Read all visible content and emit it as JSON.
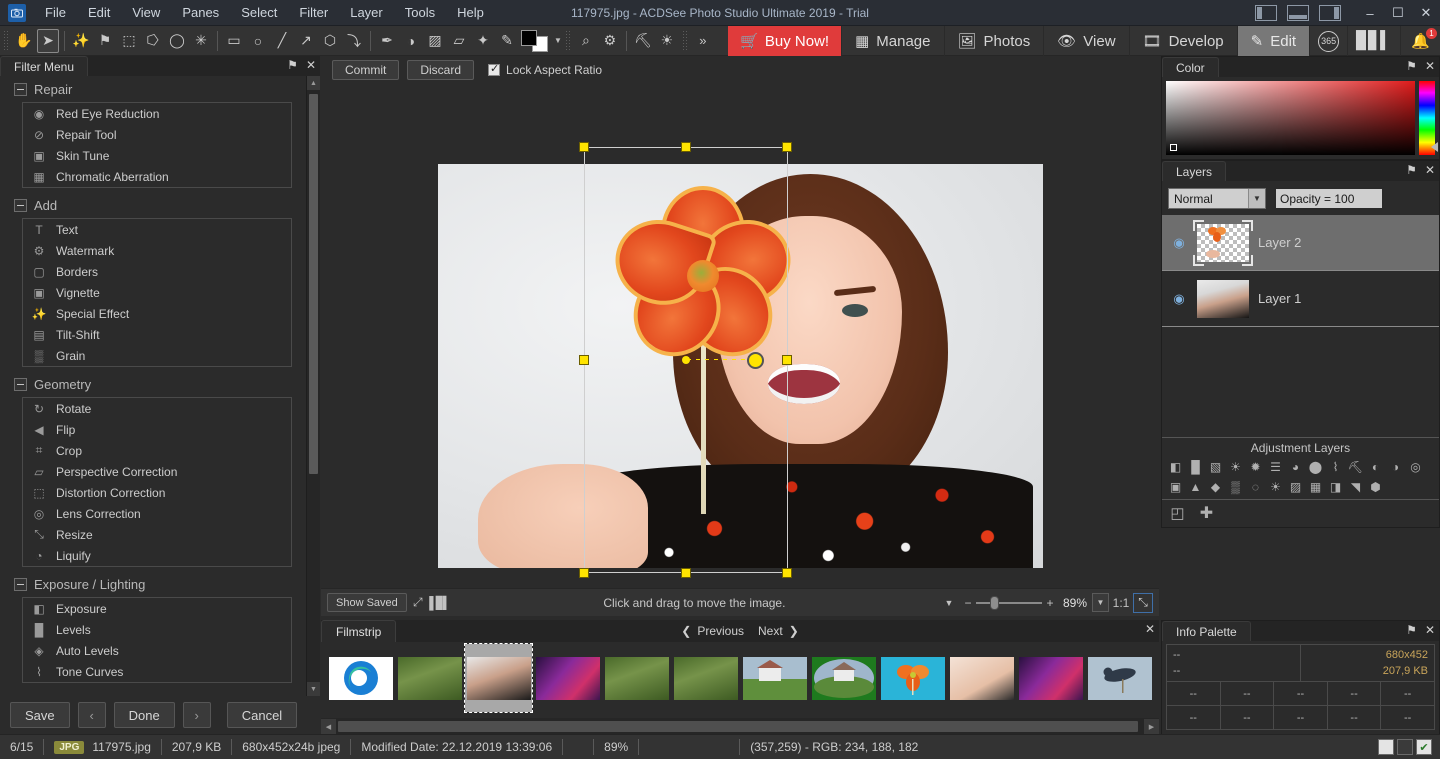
{
  "window": {
    "title": "117975.jpg - ACDSee Photo Studio Ultimate 2019 - Trial",
    "logo_icon": "camera-icon",
    "minimize_label": "–",
    "maximize_label": "☐",
    "close_label": "✕",
    "pane_left_name": "toggle-left-pane",
    "pane_bottom_name": "toggle-bottom-pane",
    "pane_right_name": "toggle-right-pane"
  },
  "menubar": {
    "items": [
      "File",
      "Edit",
      "View",
      "Panes",
      "Select",
      "Filter",
      "Layer",
      "Tools",
      "Help"
    ]
  },
  "toolbar": {
    "tools": [
      {
        "name": "hand-tool-icon",
        "glyph": "✋"
      },
      {
        "name": "move-tool-icon",
        "glyph": "➤",
        "active": true
      },
      {
        "name": "magic-wand-select-icon",
        "glyph": "✨"
      },
      {
        "name": "flag-select-icon",
        "glyph": "⚑"
      },
      {
        "name": "smart-select-icon",
        "glyph": "⬚"
      },
      {
        "name": "freehand-select-icon",
        "glyph": "⭔"
      },
      {
        "name": "lasso-select-icon",
        "glyph": "◯"
      },
      {
        "name": "magic-select-icon",
        "glyph": "✳"
      },
      {
        "name": "rectangle-shape-icon",
        "glyph": "▭"
      },
      {
        "name": "ellipse-shape-icon",
        "glyph": "○"
      },
      {
        "name": "line-shape-icon",
        "glyph": "╱"
      },
      {
        "name": "arrow-shape-icon",
        "glyph": "↗"
      },
      {
        "name": "polygon-shape-icon",
        "glyph": "⬡"
      },
      {
        "name": "curve-shape-icon",
        "glyph": "⤵"
      },
      {
        "name": "pen-tool-icon",
        "glyph": "✒"
      },
      {
        "name": "fill-tool-icon",
        "glyph": "◑"
      },
      {
        "name": "gradient-tool-icon",
        "glyph": "▨"
      },
      {
        "name": "eraser-tool-icon",
        "glyph": "▱"
      },
      {
        "name": "blemish-remover-icon",
        "glyph": "✦"
      },
      {
        "name": "brush-tool-icon",
        "glyph": "✎"
      }
    ],
    "extra_tools": [
      {
        "name": "zoom-tool-icon",
        "glyph": "⌕"
      },
      {
        "name": "settings-tool-icon",
        "glyph": "⚙"
      },
      {
        "name": "dodge-tool-icon",
        "glyph": "⛏"
      },
      {
        "name": "burn-tool-icon",
        "glyph": "☀"
      }
    ],
    "color_well_name": "foreground-background-color-well",
    "foreground_color": "#000000",
    "background_color": "#ffffff",
    "overflow_label": "»"
  },
  "modes": {
    "buy_now": "Buy Now!",
    "items": [
      {
        "label": "Manage",
        "icon": "grid-icon",
        "selected": false
      },
      {
        "label": "Photos",
        "icon": "photos-icon",
        "selected": false
      },
      {
        "label": "View",
        "icon": "eye-icon",
        "selected": false
      },
      {
        "label": "Develop",
        "icon": "develop-icon",
        "selected": false
      },
      {
        "label": "Edit",
        "icon": "edit-icon",
        "selected": true
      }
    ],
    "cloud_365": "365",
    "stats_icon": "bar-chart-icon",
    "notify_icon": "notifications-icon",
    "notify_badge": "1"
  },
  "filter_menu": {
    "tab": "Filter Menu",
    "pin_glyph": "⚑",
    "close_glyph": "✕",
    "groups": [
      {
        "title": "Repair",
        "items": [
          {
            "label": "Red Eye Reduction",
            "icon": "red-eye-icon",
            "glyph": "◉"
          },
          {
            "label": "Repair Tool",
            "icon": "bandage-icon",
            "glyph": "⊘"
          },
          {
            "label": "Skin Tune",
            "icon": "portrait-icon",
            "glyph": "▣"
          },
          {
            "label": "Chromatic Aberration",
            "icon": "chromatic-icon",
            "glyph": "▦"
          }
        ]
      },
      {
        "title": "Add",
        "items": [
          {
            "label": "Text",
            "icon": "text-icon",
            "glyph": "T"
          },
          {
            "label": "Watermark",
            "icon": "watermark-icon",
            "glyph": "⚙"
          },
          {
            "label": "Borders",
            "icon": "borders-icon",
            "glyph": "▢"
          },
          {
            "label": "Vignette",
            "icon": "vignette-icon",
            "glyph": "▣"
          },
          {
            "label": "Special Effect",
            "icon": "special-effect-icon",
            "glyph": "✨"
          },
          {
            "label": "Tilt-Shift",
            "icon": "tilt-shift-icon",
            "glyph": "▤"
          },
          {
            "label": "Grain",
            "icon": "grain-icon",
            "glyph": "▒"
          }
        ]
      },
      {
        "title": "Geometry",
        "items": [
          {
            "label": "Rotate",
            "icon": "rotate-icon",
            "glyph": "↻"
          },
          {
            "label": "Flip",
            "icon": "flip-icon",
            "glyph": "◀"
          },
          {
            "label": "Crop",
            "icon": "crop-icon",
            "glyph": "⌗"
          },
          {
            "label": "Perspective Correction",
            "icon": "perspective-icon",
            "glyph": "▱"
          },
          {
            "label": "Distortion Correction",
            "icon": "distortion-icon",
            "glyph": "⬚"
          },
          {
            "label": "Lens Correction",
            "icon": "lens-icon",
            "glyph": "◎"
          },
          {
            "label": "Resize",
            "icon": "resize-icon",
            "glyph": "⤡"
          },
          {
            "label": "Liquify",
            "icon": "liquify-icon",
            "glyph": "◔"
          }
        ]
      },
      {
        "title": "Exposure / Lighting",
        "items": [
          {
            "label": "Exposure",
            "icon": "exposure-icon",
            "glyph": "◧"
          },
          {
            "label": "Levels",
            "icon": "levels-icon",
            "glyph": "█"
          },
          {
            "label": "Auto Levels",
            "icon": "auto-levels-icon",
            "glyph": "◈"
          },
          {
            "label": "Tone Curves",
            "icon": "tone-curves-icon",
            "glyph": "⌇"
          }
        ]
      }
    ]
  },
  "actions": {
    "save": "Save",
    "prev": "‹",
    "done": "Done",
    "next": "›",
    "cancel": "Cancel"
  },
  "editor": {
    "commit": "Commit",
    "discard": "Discard",
    "lock_aspect_label": "Lock Aspect Ratio",
    "lock_aspect_checked": true,
    "hint": "Click and drag to move the image.",
    "show_saved": "Show Saved",
    "fit_icon": "fit-to-window-icon",
    "histogram_icon": "histogram-icon",
    "zoom_value": "89%",
    "one_to_one": "1:1",
    "expand_icon": "expand-icon",
    "zoom_minus": "−",
    "zoom_plus": "+",
    "zoom_dropdown": "▼"
  },
  "filmstrip": {
    "tab": "Filmstrip",
    "previous": "Previous",
    "next": "Next",
    "close_glyph": "✕",
    "prev_chevron": "❮",
    "next_chevron": "❯",
    "thumbs": [
      {
        "name": "thumb-edge-logo",
        "kind": "edge",
        "selected": false
      },
      {
        "name": "thumb-woman-forest-1",
        "kind": "forest",
        "selected": false
      },
      {
        "name": "thumb-portrait-current",
        "kind": "portrait",
        "selected": true
      },
      {
        "name": "thumb-concert-1",
        "kind": "concert",
        "selected": false
      },
      {
        "name": "thumb-woman-forest-2",
        "kind": "forest",
        "selected": false
      },
      {
        "name": "thumb-woman-forest-3",
        "kind": "forest",
        "selected": false
      },
      {
        "name": "thumb-house-1",
        "kind": "house",
        "selected": false
      },
      {
        "name": "thumb-house-2",
        "kind": "house-oval",
        "selected": false
      },
      {
        "name": "thumb-pinwheel",
        "kind": "pinwheel",
        "selected": false
      },
      {
        "name": "thumb-skin-closeup",
        "kind": "skin",
        "selected": false
      },
      {
        "name": "thumb-concert-2",
        "kind": "concert",
        "selected": false
      },
      {
        "name": "thumb-bird",
        "kind": "bird",
        "selected": false
      }
    ]
  },
  "color_panel": {
    "tab": "Color",
    "pin_glyph": "⚑",
    "close_glyph": "✕",
    "base_hue": "#e01b1b"
  },
  "layers_panel": {
    "tab": "Layers",
    "pin_glyph": "⚑",
    "close_glyph": "✕",
    "blend_mode": "Normal",
    "blend_arrow": "▼",
    "opacity": "Opacity = 100",
    "layers": [
      {
        "name": "Layer 2",
        "selected": true,
        "visible": true,
        "kind": "transparent"
      },
      {
        "name": "Layer 1",
        "selected": false,
        "visible": true,
        "kind": "portrait"
      }
    ],
    "eye_glyph": "◉",
    "adjustment_title": "Adjustment Layers",
    "adjustment_icons": [
      {
        "name": "exposure-adj-icon",
        "glyph": "◧"
      },
      {
        "name": "levels-adj-icon",
        "glyph": "█"
      },
      {
        "name": "tone-curves-adj-icon",
        "glyph": "▧"
      },
      {
        "name": "light-eq-adj-icon",
        "glyph": "☀"
      },
      {
        "name": "brightness-adj-icon",
        "glyph": "✹"
      },
      {
        "name": "color-eq-adj-icon",
        "glyph": "☰"
      },
      {
        "name": "color-balance-adj-icon",
        "glyph": "◕"
      },
      {
        "name": "white-balance-adj-icon",
        "glyph": "⬤"
      },
      {
        "name": "tone-curve2-adj-icon",
        "glyph": "⌇"
      },
      {
        "name": "dodge-burn-adj-icon",
        "glyph": "⛏"
      },
      {
        "name": "contrast-adj-icon",
        "glyph": "◐"
      },
      {
        "name": "split-tone-adj-icon",
        "glyph": "◑"
      },
      {
        "name": "vignette-adj-icon",
        "glyph": "◎"
      },
      {
        "name": "skin-tune-adj-icon",
        "glyph": "▣"
      },
      {
        "name": "grayscale-adj-icon",
        "glyph": "▲"
      },
      {
        "name": "saturation-adj-icon",
        "glyph": "◆"
      },
      {
        "name": "noise-adj-icon",
        "glyph": "▒"
      },
      {
        "name": "soft-focus-adj-icon",
        "glyph": "◌"
      },
      {
        "name": "photo-effect-adj-icon",
        "glyph": "☀"
      },
      {
        "name": "gradient-adj-icon",
        "glyph": "▨"
      },
      {
        "name": "texture-adj-icon",
        "glyph": "▦"
      },
      {
        "name": "diagonal-adj-icon",
        "glyph": "◨"
      },
      {
        "name": "curves2-adj-icon",
        "glyph": "◥"
      },
      {
        "name": "color-lut-adj-icon",
        "glyph": "⬢"
      }
    ],
    "add_mask_icon": "add-layer-mask-icon",
    "add_layer_icon": "add-layer-icon",
    "add_mask_glyph": "◰",
    "add_layer_glyph": "✚"
  },
  "info_panel": {
    "tab": "Info Palette",
    "pin_glyph": "⚑",
    "close_glyph": "✕",
    "left_line1": "--",
    "left_line2": "--",
    "right_line1": "680x452",
    "right_line2": "207,9 KB",
    "row1": [
      "--",
      "--",
      "--",
      "--",
      "--"
    ],
    "row2": [
      "--",
      "--",
      "--",
      "--",
      "--"
    ],
    "footer": "--"
  },
  "statusbar": {
    "index": "6/15",
    "format_badge": "JPG",
    "filename": "117975.jpg",
    "filesize": "207,9 KB",
    "dimensions": "680x452x24b jpeg",
    "modified": "Modified Date: 22.12.2019 13:39:06",
    "zoom": "89%",
    "pixel_info": "(357,259) - RGB: 234, 188, 182",
    "toggles": [
      {
        "name": "status-toggle-light",
        "glyph": ""
      },
      {
        "name": "status-toggle-split",
        "glyph": ""
      },
      {
        "name": "status-toggle-check",
        "glyph": "✔"
      }
    ]
  }
}
